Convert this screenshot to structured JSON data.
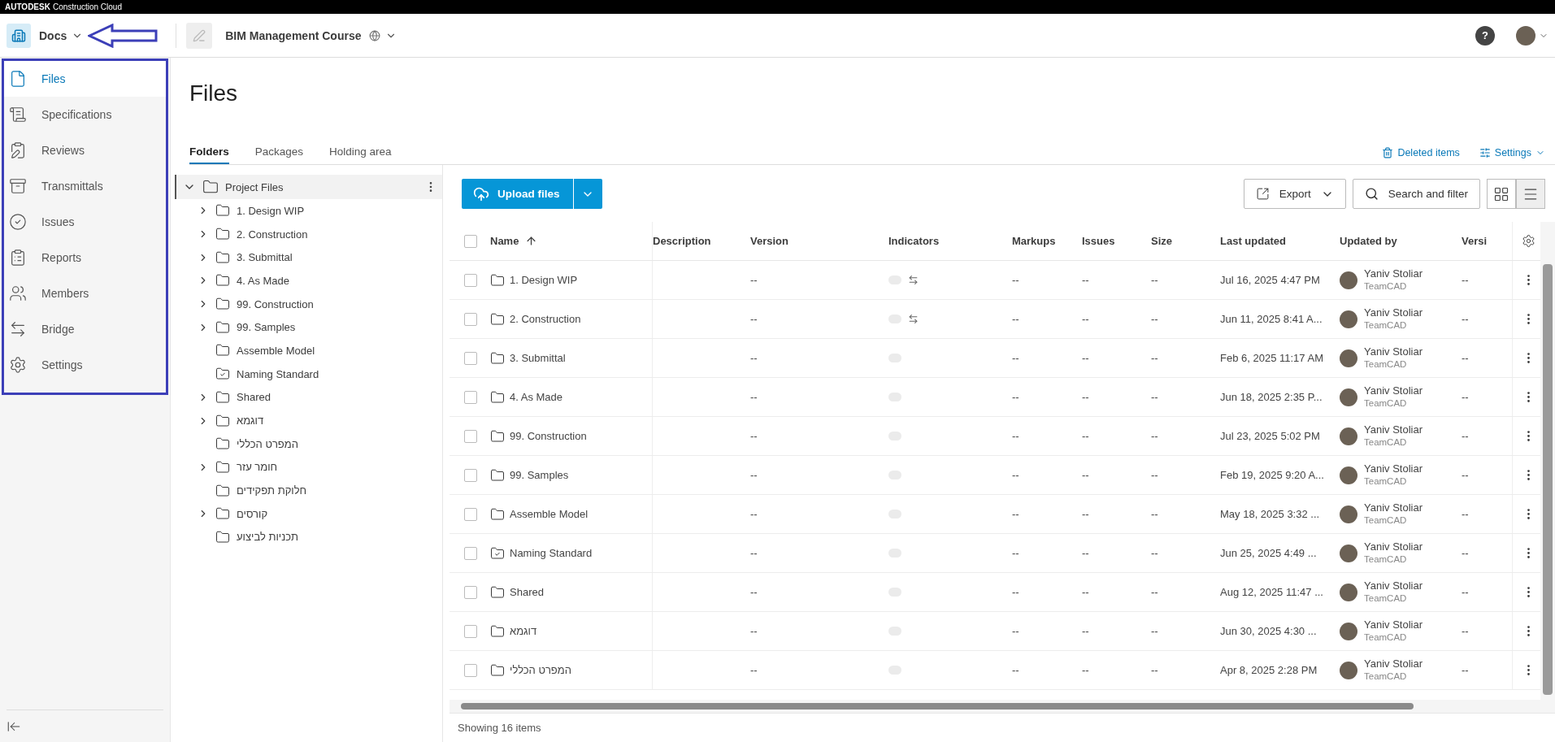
{
  "brand": {
    "name": "AUTODESK",
    "product": "Construction Cloud"
  },
  "header": {
    "app": "Docs",
    "project": "BIM Management Course",
    "help": "?"
  },
  "sidebar": {
    "items": [
      {
        "label": "Files",
        "selected": true
      },
      {
        "label": "Specifications",
        "selected": false
      },
      {
        "label": "Reviews",
        "selected": false
      },
      {
        "label": "Transmittals",
        "selected": false
      },
      {
        "label": "Issues",
        "selected": false
      },
      {
        "label": "Reports",
        "selected": false
      },
      {
        "label": "Members",
        "selected": false
      },
      {
        "label": "Bridge",
        "selected": false
      },
      {
        "label": "Settings",
        "selected": false
      }
    ]
  },
  "page": {
    "title": "Files"
  },
  "tabs": [
    {
      "label": "Folders",
      "selected": true
    },
    {
      "label": "Packages",
      "selected": false
    },
    {
      "label": "Holding area",
      "selected": false
    }
  ],
  "links": [
    {
      "label": "Deleted items",
      "kind": "trash"
    },
    {
      "label": "Settings",
      "kind": "settings"
    }
  ],
  "tree": {
    "root": {
      "label": "Project Files",
      "expanded": true,
      "selected": true,
      "children": [
        {
          "label": "1. Design WIP",
          "kind": "folder",
          "expandable": true
        },
        {
          "label": "2. Construction",
          "kind": "folder",
          "expandable": true
        },
        {
          "label": "3. Submittal",
          "kind": "folder",
          "expandable": true
        },
        {
          "label": "4. As Made",
          "kind": "folder",
          "expandable": true
        },
        {
          "label": "99. Construction",
          "kind": "folder",
          "expandable": true
        },
        {
          "label": "99. Samples",
          "kind": "folder",
          "expandable": true
        },
        {
          "label": "Assemble Model",
          "kind": "folder",
          "expandable": false
        },
        {
          "label": "Naming Standard",
          "kind": "standard",
          "expandable": false
        },
        {
          "label": "Shared",
          "kind": "folder",
          "expandable": true
        },
        {
          "label": "דוגמא",
          "kind": "folder",
          "expandable": true
        },
        {
          "label": "המפרט הכללי",
          "kind": "folder",
          "expandable": false
        },
        {
          "label": "חומר עזר",
          "kind": "folder",
          "expandable": true
        },
        {
          "label": "חלוקת תפקידים",
          "kind": "folder",
          "expandable": false
        },
        {
          "label": "קורסים",
          "kind": "folder",
          "expandable": true
        },
        {
          "label": "תכניות לביצוע",
          "kind": "folder",
          "expandable": false
        }
      ]
    }
  },
  "toolbar": {
    "upload": "Upload files",
    "export": "Export",
    "search": "Search and filter",
    "views": [
      {
        "kind": "grid",
        "selected": false
      },
      {
        "kind": "list",
        "selected": true
      }
    ]
  },
  "table": {
    "select_all_checked": false,
    "columns": [
      {
        "label": "Name",
        "sorted": true
      },
      {
        "label": "Description",
        "sorted": false
      },
      {
        "label": "Version",
        "sorted": false
      },
      {
        "label": "Indicators",
        "sorted": false
      },
      {
        "label": "Markups",
        "sorted": false
      },
      {
        "label": "Issues",
        "sorted": false
      },
      {
        "label": "Size",
        "sorted": false
      },
      {
        "label": "Last updated",
        "sorted": false
      },
      {
        "label": "Updated by",
        "sorted": false
      },
      {
        "label": "Versi",
        "sorted": false
      }
    ],
    "rows": [
      {
        "name": "1. Design WIP",
        "kind": "folder",
        "checked": false,
        "version": "--",
        "synced": true,
        "markups": "--",
        "issues": "--",
        "size": "--",
        "last_updated": "Jul 16, 2025 4:47 PM",
        "user": "Yaniv Stoliar",
        "company": "TeamCAD",
        "versi": "--"
      },
      {
        "name": "2. Construction",
        "kind": "folder",
        "checked": false,
        "version": "--",
        "synced": true,
        "markups": "--",
        "issues": "--",
        "size": "--",
        "last_updated": "Jun 11, 2025 8:41 A...",
        "user": "Yaniv Stoliar",
        "company": "TeamCAD",
        "versi": "--"
      },
      {
        "name": "3. Submittal",
        "kind": "folder",
        "checked": false,
        "version": "--",
        "synced": false,
        "markups": "--",
        "issues": "--",
        "size": "--",
        "last_updated": "Feb 6, 2025 11:17 AM",
        "user": "Yaniv Stoliar",
        "company": "TeamCAD",
        "versi": "--"
      },
      {
        "name": "4. As Made",
        "kind": "folder",
        "checked": false,
        "version": "--",
        "synced": false,
        "markups": "--",
        "issues": "--",
        "size": "--",
        "last_updated": "Jun 18, 2025 2:35 P...",
        "user": "Yaniv Stoliar",
        "company": "TeamCAD",
        "versi": "--"
      },
      {
        "name": "99. Construction",
        "kind": "folder",
        "checked": false,
        "version": "--",
        "synced": false,
        "markups": "--",
        "issues": "--",
        "size": "--",
        "last_updated": "Jul 23, 2025 5:02 PM",
        "user": "Yaniv Stoliar",
        "company": "TeamCAD",
        "versi": "--"
      },
      {
        "name": "99. Samples",
        "kind": "folder",
        "checked": false,
        "version": "--",
        "synced": false,
        "markups": "--",
        "issues": "--",
        "size": "--",
        "last_updated": "Feb 19, 2025 9:20 A...",
        "user": "Yaniv Stoliar",
        "company": "TeamCAD",
        "versi": "--"
      },
      {
        "name": "Assemble Model",
        "kind": "folder",
        "checked": false,
        "version": "--",
        "synced": false,
        "markups": "--",
        "issues": "--",
        "size": "--",
        "last_updated": "May 18, 2025 3:32 ...",
        "user": "Yaniv Stoliar",
        "company": "TeamCAD",
        "versi": "--"
      },
      {
        "name": "Naming Standard",
        "kind": "standard",
        "checked": false,
        "version": "--",
        "synced": false,
        "markups": "--",
        "issues": "--",
        "size": "--",
        "last_updated": "Jun 25, 2025 4:49 ...",
        "user": "Yaniv Stoliar",
        "company": "TeamCAD",
        "versi": "--"
      },
      {
        "name": "Shared",
        "kind": "folder",
        "checked": false,
        "version": "--",
        "synced": false,
        "markups": "--",
        "issues": "--",
        "size": "--",
        "last_updated": "Aug 12, 2025 11:47 ...",
        "user": "Yaniv Stoliar",
        "company": "TeamCAD",
        "versi": "--"
      },
      {
        "name": "דוגמא",
        "kind": "folder",
        "checked": false,
        "version": "--",
        "synced": false,
        "markups": "--",
        "issues": "--",
        "size": "--",
        "last_updated": "Jun 30, 2025 4:30 ...",
        "user": "Yaniv Stoliar",
        "company": "TeamCAD",
        "versi": "--"
      },
      {
        "name": "המפרט הכללי",
        "kind": "folder",
        "checked": false,
        "version": "--",
        "synced": false,
        "markups": "--",
        "issues": "--",
        "size": "--",
        "last_updated": "Apr 8, 2025 2:28 PM",
        "user": "Yaniv Stoliar",
        "company": "TeamCAD",
        "versi": "--"
      }
    ]
  },
  "footer": {
    "status": "Showing 16 items"
  }
}
